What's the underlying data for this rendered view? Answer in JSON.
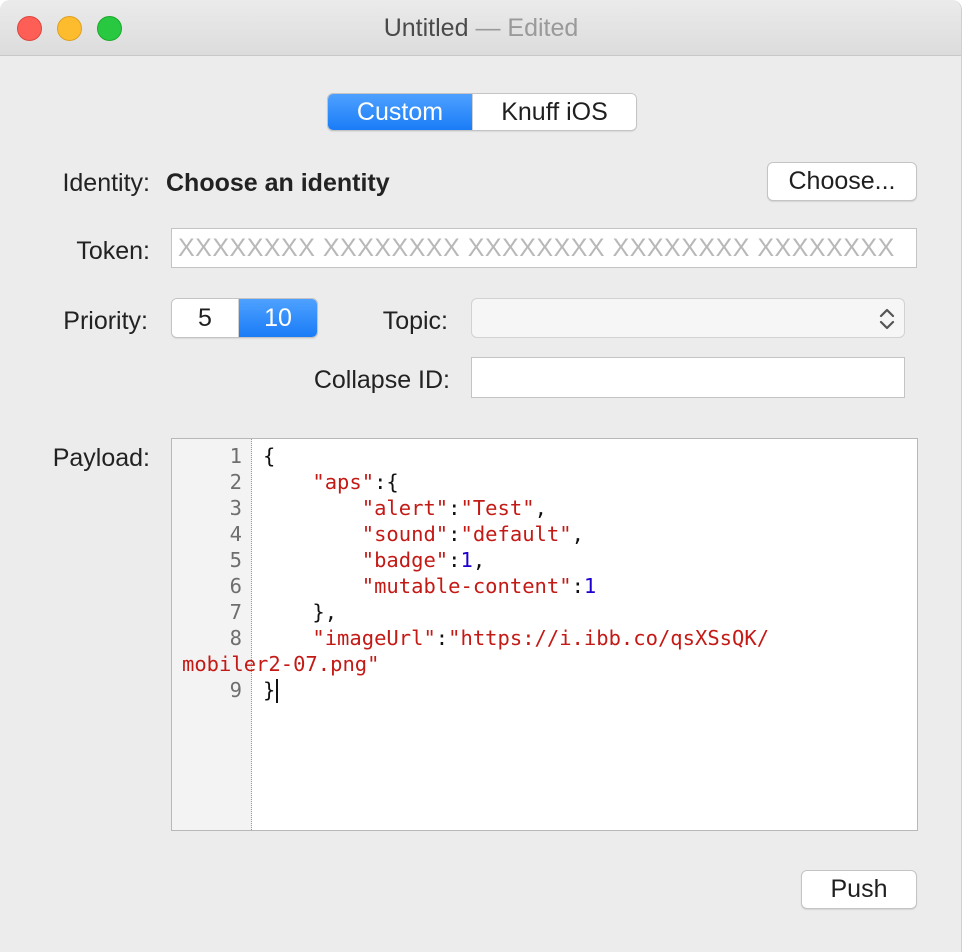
{
  "window": {
    "title": "Untitled",
    "separator": "—",
    "status": "Edited"
  },
  "mode_selector": {
    "options": [
      "Custom",
      "Knuff iOS"
    ],
    "selected": "Custom"
  },
  "identity": {
    "label": "Identity:",
    "value": "Choose an identity",
    "choose_button": "Choose..."
  },
  "token": {
    "label": "Token:",
    "value": "",
    "placeholder": "XXXXXXXX XXXXXXXX XXXXXXXX XXXXXXXX XXXXXXXX"
  },
  "priority": {
    "label": "Priority:",
    "options": [
      "5",
      "10"
    ],
    "selected": "10"
  },
  "topic": {
    "label": "Topic:",
    "value": ""
  },
  "collapse_id": {
    "label": "Collapse ID:",
    "value": ""
  },
  "payload": {
    "label": "Payload:",
    "line_numbers": [
      "1",
      "2",
      "3",
      "4",
      "5",
      "6",
      "7",
      "8",
      "9"
    ],
    "lines": [
      {
        "n": "1",
        "parts": [
          {
            "t": "{",
            "c": "p"
          }
        ]
      },
      {
        "n": "2",
        "parts": [
          {
            "t": "    ",
            "c": "p"
          },
          {
            "t": "\"aps\"",
            "c": "s"
          },
          {
            "t": ":{",
            "c": "p"
          }
        ]
      },
      {
        "n": "3",
        "parts": [
          {
            "t": "        ",
            "c": "p"
          },
          {
            "t": "\"alert\"",
            "c": "s"
          },
          {
            "t": ":",
            "c": "p"
          },
          {
            "t": "\"Test\"",
            "c": "s"
          },
          {
            "t": ",",
            "c": "p"
          }
        ]
      },
      {
        "n": "4",
        "parts": [
          {
            "t": "        ",
            "c": "p"
          },
          {
            "t": "\"sound\"",
            "c": "s"
          },
          {
            "t": ":",
            "c": "p"
          },
          {
            "t": "\"default\"",
            "c": "s"
          },
          {
            "t": ",",
            "c": "p"
          }
        ]
      },
      {
        "n": "5",
        "parts": [
          {
            "t": "        ",
            "c": "p"
          },
          {
            "t": "\"badge\"",
            "c": "s"
          },
          {
            "t": ":",
            "c": "p"
          },
          {
            "t": "1",
            "c": "n"
          },
          {
            "t": ",",
            "c": "p"
          }
        ]
      },
      {
        "n": "6",
        "parts": [
          {
            "t": "        ",
            "c": "p"
          },
          {
            "t": "\"mutable-content\"",
            "c": "s"
          },
          {
            "t": ":",
            "c": "p"
          },
          {
            "t": "1",
            "c": "n"
          }
        ]
      },
      {
        "n": "7",
        "parts": [
          {
            "t": "    },",
            "c": "p"
          }
        ]
      },
      {
        "n": "8",
        "parts": [
          {
            "t": "    ",
            "c": "p"
          },
          {
            "t": "\"imageUrl\"",
            "c": "s"
          },
          {
            "t": ":",
            "c": "p"
          },
          {
            "t": "\"https://i.ibb.co/qsXSsQK/",
            "c": "s"
          }
        ]
      },
      {
        "n": "",
        "wrap": true,
        "parts": [
          {
            "t": "mobiler2-07.png\"",
            "c": "s"
          }
        ]
      },
      {
        "n": "9",
        "parts": [
          {
            "t": "}",
            "c": "p"
          }
        ],
        "caret": true
      }
    ]
  },
  "push_button": "Push",
  "colors": {
    "accent": "#1a7cf7",
    "string": "#c41a16",
    "number": "#1c00cf"
  }
}
